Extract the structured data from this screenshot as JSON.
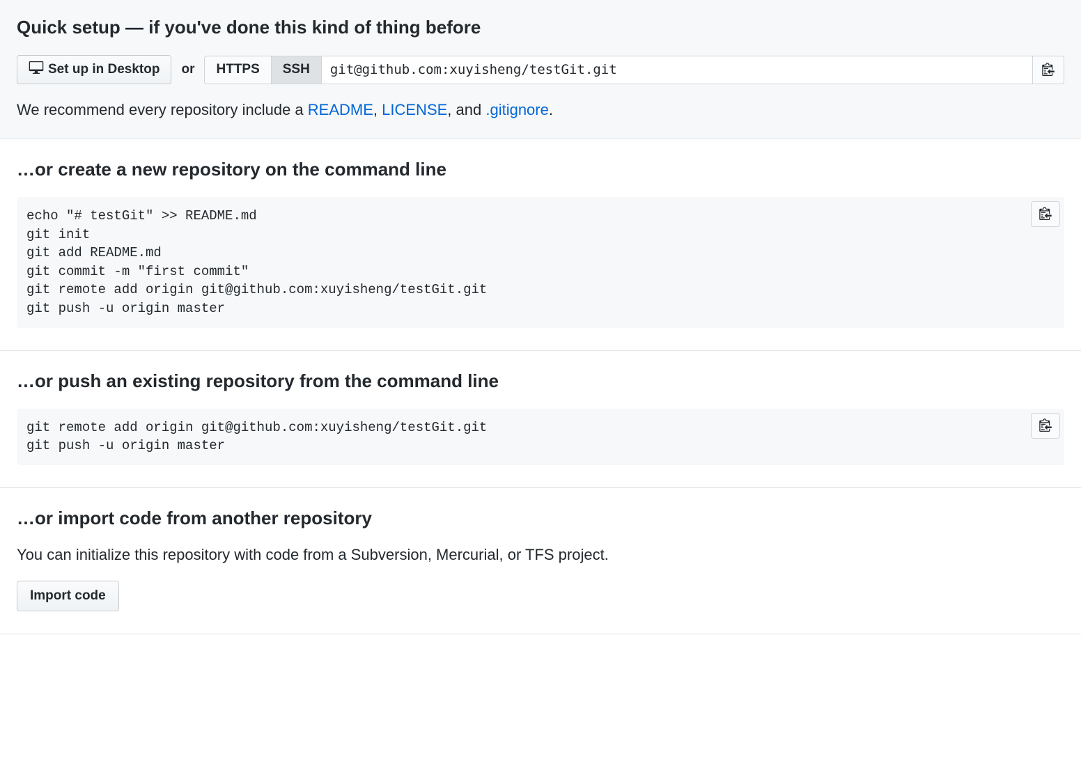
{
  "quickSetup": {
    "heading": "Quick setup — if you've done this kind of thing before",
    "desktopButton": "Set up in Desktop",
    "orText": "or",
    "httpsLabel": "HTTPS",
    "sshLabel": "SSH",
    "cloneUrl": "git@github.com:xuyisheng/testGit.git",
    "recommendPrefix": "We recommend every repository include a ",
    "readmeLink": "README",
    "commaSep": ", ",
    "licenseLink": "LICENSE",
    "andSep": ", and ",
    "gitignoreLink": ".gitignore",
    "period": "."
  },
  "createSection": {
    "heading": "…or create a new repository on the command line",
    "code": "echo \"# testGit\" >> README.md\ngit init\ngit add README.md\ngit commit -m \"first commit\"\ngit remote add origin git@github.com:xuyisheng/testGit.git\ngit push -u origin master"
  },
  "pushSection": {
    "heading": "…or push an existing repository from the command line",
    "code": "git remote add origin git@github.com:xuyisheng/testGit.git\ngit push -u origin master"
  },
  "importSection": {
    "heading": "…or import code from another repository",
    "description": "You can initialize this repository with code from a Subversion, Mercurial, or TFS project.",
    "buttonLabel": "Import code"
  }
}
